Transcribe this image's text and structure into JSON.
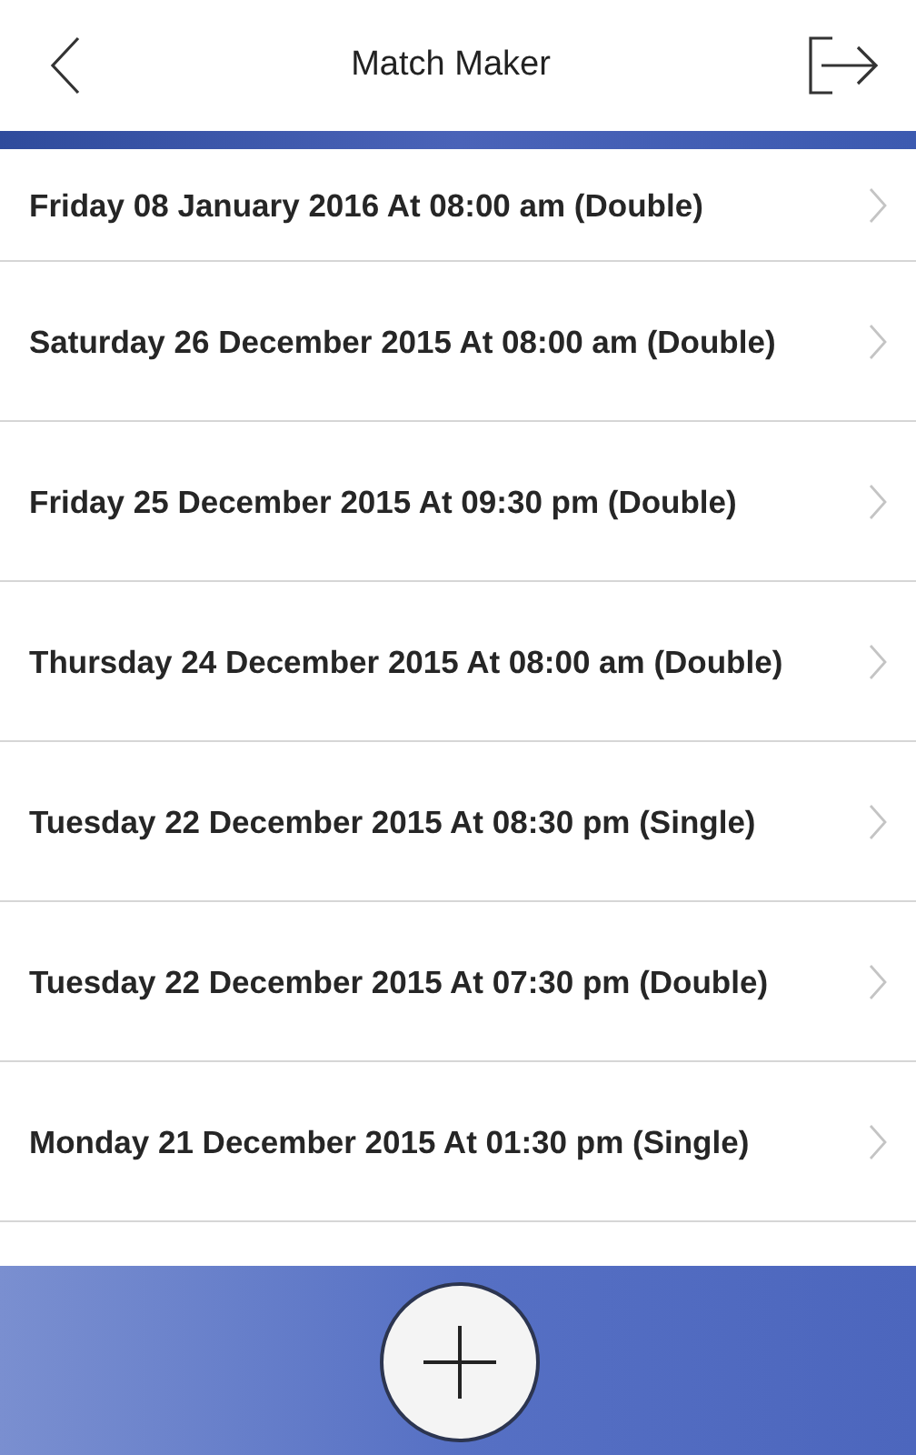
{
  "header": {
    "title": "Match Maker"
  },
  "matches": [
    {
      "label": "Friday 08 January 2016 At 08:00 am (Double)"
    },
    {
      "label": "Saturday 26 December 2015 At 08:00 am (Double)"
    },
    {
      "label": "Friday 25 December 2015 At 09:30 pm (Double)"
    },
    {
      "label": "Thursday 24 December 2015 At 08:00 am (Double)"
    },
    {
      "label": "Tuesday 22 December 2015 At 08:30 pm (Single)"
    },
    {
      "label": "Tuesday 22 December 2015 At 07:30 pm (Double)"
    },
    {
      "label": "Monday 21 December 2015 At 01:30 pm (Single)"
    }
  ]
}
